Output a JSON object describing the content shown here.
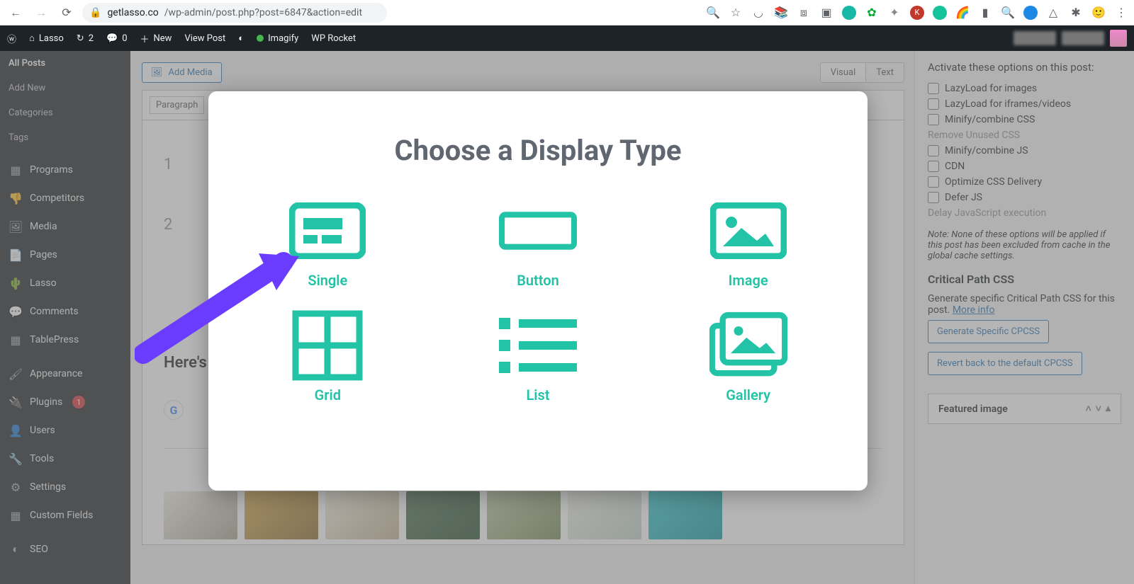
{
  "chrome": {
    "url_domain": "getlasso.co",
    "url_path": "/wp-admin/post.php?post=6847&action=edit"
  },
  "adminbar": {
    "site": "Lasso",
    "updates": "2",
    "comments": "0",
    "new": "New",
    "view": "View Post",
    "imagify": "Imagify",
    "wprocket": "WP Rocket"
  },
  "sidebar": {
    "posts_sub": [
      "All Posts",
      "Add New",
      "Categories",
      "Tags"
    ],
    "items": [
      {
        "label": "Programs",
        "icon": "▦"
      },
      {
        "label": "Competitors",
        "icon": "👎"
      },
      {
        "label": "Media",
        "icon": "🖼"
      },
      {
        "label": "Pages",
        "icon": "📄"
      },
      {
        "label": "Lasso",
        "icon": "🌵"
      },
      {
        "label": "Comments",
        "icon": "💬"
      },
      {
        "label": "TablePress",
        "icon": "▦"
      }
    ],
    "items2": [
      {
        "label": "Appearance",
        "icon": "🖌"
      },
      {
        "label": "Plugins",
        "icon": "🔌",
        "badge": "1"
      },
      {
        "label": "Users",
        "icon": "👤"
      },
      {
        "label": "Tools",
        "icon": "🔧"
      },
      {
        "label": "Settings",
        "icon": "⚙"
      },
      {
        "label": "Custom Fields",
        "icon": "▦"
      }
    ],
    "items3": [
      {
        "label": "SEO",
        "icon": "◐"
      }
    ]
  },
  "editor": {
    "add_media": "Add Media",
    "visual": "Visual",
    "text": "Text",
    "format": "Paragraph",
    "line1": "1",
    "line2": "2",
    "heading": "Here's h",
    "google": "G"
  },
  "rail": {
    "activate": "Activate these options on this post:",
    "opts": [
      {
        "label": "LazyLoad for images",
        "disabled": false
      },
      {
        "label": "LazyLoad for iframes/videos",
        "disabled": false
      },
      {
        "label": "Minify/combine CSS",
        "disabled": false
      },
      {
        "label": "Remove Unused CSS",
        "disabled": true
      },
      {
        "label": "Minify/combine JS",
        "disabled": false
      },
      {
        "label": "CDN",
        "disabled": false
      },
      {
        "label": "Optimize CSS Delivery",
        "disabled": false
      },
      {
        "label": "Defer JS",
        "disabled": false
      },
      {
        "label": "Delay JavaScript execution",
        "disabled": true
      }
    ],
    "note": "Note: None of these options will be applied if this post has been excluded from cache in the global cache settings.",
    "cpcss_title": "Critical Path CSS",
    "cpcss_text": "Generate specific Critical Path CSS for this post. ",
    "more_info": "More info",
    "btn_generate": "Generate Specific CPCSS",
    "btn_revert": "Revert back to the default CPCSS",
    "featured": "Featured image"
  },
  "modal": {
    "title": "Choose a Display Type",
    "opts": [
      "Single",
      "Button",
      "Image",
      "Grid",
      "List",
      "Gallery"
    ]
  }
}
